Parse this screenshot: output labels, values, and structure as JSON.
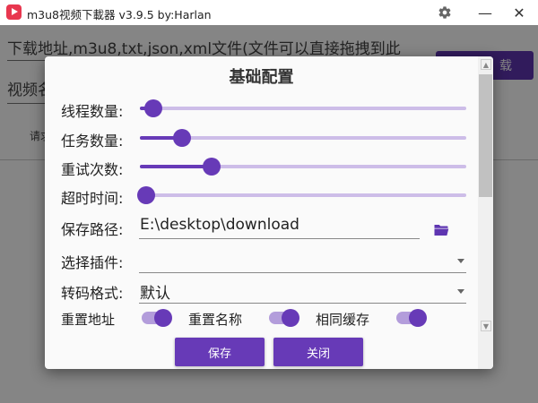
{
  "window": {
    "title": "m3u8视频下載器 v3.9.5 by:Harlan",
    "minimize_symbol": "—",
    "close_symbol": "✕"
  },
  "main": {
    "url_placeholder": "下载地址,m3u8,txt,json,xml文件(文件可以直接拖拽到此",
    "name_placeholder": "视频名",
    "download_label": "载",
    "request_label": "请求"
  },
  "dialog": {
    "title": "基础配置",
    "sliders": [
      {
        "label": "线程数量:",
        "value": 0.04
      },
      {
        "label": "任务数量:",
        "value": 0.13
      },
      {
        "label": "重试次数:",
        "value": 0.22
      },
      {
        "label": "超时时间:",
        "value": 0.02
      }
    ],
    "save_path": {
      "label": "保存路径:",
      "value": "E:\\desktop\\download"
    },
    "plugin": {
      "label": "选择插件:",
      "value": ""
    },
    "transcode": {
      "label": "转码格式:",
      "value": "默认"
    },
    "toggles": [
      {
        "label": "重置地址",
        "on": true
      },
      {
        "label": "重置名称",
        "on": true
      },
      {
        "label": "相同缓存",
        "on": true
      }
    ],
    "save_button": "保存",
    "close_button": "关闭"
  },
  "colors": {
    "accent": "#673ab7",
    "accent_light": "#cdbde8",
    "brand_logo": "#e8374f"
  },
  "icons": [
    "app-logo-icon",
    "gear-icon",
    "minimize-icon",
    "close-icon",
    "folder-icon",
    "chevron-down-icon",
    "scroll-up-icon",
    "scroll-down-icon"
  ]
}
